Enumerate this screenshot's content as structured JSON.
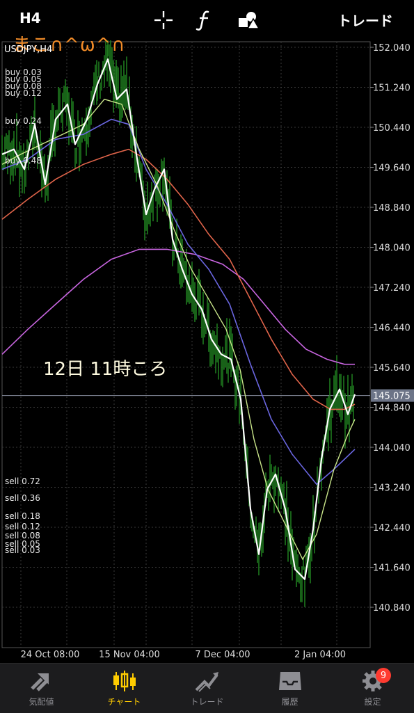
{
  "header": {
    "timeframe": "H4",
    "crosshair_icon": "crosshair-icon",
    "indicator_icon": "function-icon",
    "objects_icon": "shapes-icon",
    "trade_label": "トレード"
  },
  "chart": {
    "symbol_label": "USDJPY,H4",
    "annotation_top": "まこ∩^ω^∩",
    "annotation_mid": "12日 11時ころ",
    "price_ticks": [
      "152.040",
      "151.240",
      "150.440",
      "149.640",
      "148.840",
      "148.040",
      "147.240",
      "146.440",
      "145.640",
      "144.840",
      "144.040",
      "143.240",
      "142.440",
      "141.640",
      "140.840"
    ],
    "current_price": "145.075",
    "time_ticks": [
      "24 Oct 08:00",
      "15 Nov 04:00",
      "7 Dec 04:00",
      "2 Jan 04:00"
    ],
    "buy_levels": [
      "buy 0.03",
      "buy 0.05",
      "buy 0.08",
      "buy 0.12",
      "buy 0.24",
      "buy 0.48"
    ],
    "sell_levels": [
      "sell 0.72",
      "sell 0.36",
      "sell 0.18",
      "sell 0.12",
      "sell 0.08",
      "sell 0.05",
      "sell 0.03"
    ],
    "colors": {
      "candles": "#1f7a1f",
      "price_line": "#ffffff",
      "ma_fast": "#c9e58a",
      "ma_blue": "#6a66e0",
      "ma_red": "#e0644a",
      "ma_purple": "#c865e0",
      "annotation_orange": "#f28c28",
      "grid": "#3a3a3a"
    }
  },
  "tabbar": {
    "items": [
      {
        "label": "気配値",
        "icon": "quotes-icon"
      },
      {
        "label": "チャート",
        "icon": "chart-icon"
      },
      {
        "label": "トレード",
        "icon": "trade-icon"
      },
      {
        "label": "履歴",
        "icon": "history-icon"
      },
      {
        "label": "設定",
        "icon": "settings-icon"
      }
    ],
    "badge": "9"
  }
}
